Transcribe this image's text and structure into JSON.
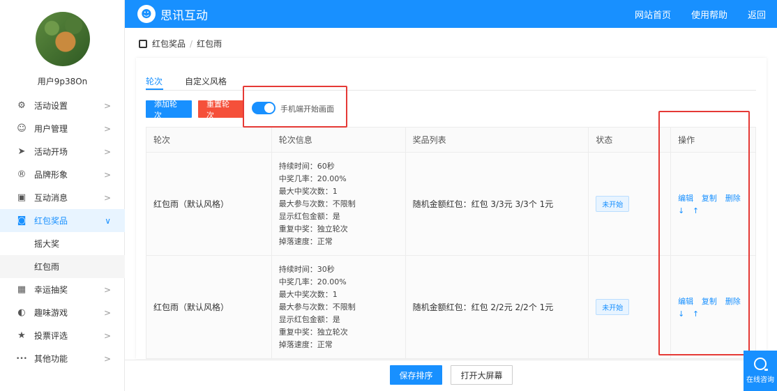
{
  "sidebar": {
    "username": "用户9p38On",
    "items": [
      {
        "label": "活动设置",
        "icon": "gears-icon",
        "glyph": "⚙",
        "arrow": ">"
      },
      {
        "label": "用户管理",
        "icon": "user-icon",
        "glyph": "☺",
        "arrow": ">"
      },
      {
        "label": "活动开场",
        "icon": "send-icon",
        "glyph": "➤",
        "arrow": ">"
      },
      {
        "label": "品牌形象",
        "icon": "registered-icon",
        "glyph": "®",
        "arrow": ">"
      },
      {
        "label": "互动消息",
        "icon": "message-icon",
        "glyph": "▣",
        "arrow": ">"
      },
      {
        "label": "红包奖品",
        "icon": "redpacket-icon",
        "glyph": "◙",
        "arrow": "∨"
      },
      {
        "label": "幸运抽奖",
        "icon": "lottery-icon",
        "glyph": "▦",
        "arrow": ">"
      },
      {
        "label": "趣味游戏",
        "icon": "game-icon",
        "glyph": "◐",
        "arrow": ">"
      },
      {
        "label": "投票评选",
        "icon": "star-icon",
        "glyph": "★",
        "arrow": ">"
      },
      {
        "label": "其他功能",
        "icon": "more-icon",
        "glyph": "•••",
        "arrow": ">"
      }
    ],
    "submenu": [
      "摇大奖",
      "红包雨"
    ]
  },
  "header": {
    "brand": "思讯互动",
    "links": [
      "网站首页",
      "使用帮助",
      "返回"
    ]
  },
  "breadcrumb": {
    "parent": "红包奖品",
    "separator": "/",
    "current": "红包雨"
  },
  "tabs": [
    "轮次",
    "自定义风格"
  ],
  "toolbar": {
    "add_label": "添加轮次",
    "reset_label": "重置轮次",
    "toggle_label": "手机端开始画面"
  },
  "table": {
    "headers": [
      "轮次",
      "轮次信息",
      "奖品列表",
      "状态",
      "操作"
    ],
    "rows": [
      {
        "round": "红包雨（默认风格）",
        "info": [
          "持续时间：60秒",
          "中奖几率：20.00%",
          "最大中奖次数：1",
          "最大参与次数：不限制",
          "显示红包金额：是",
          "重复中奖：独立轮次",
          "掉落速度：正常"
        ],
        "prizes": "随机金额红包：红包 3/3元 3/3个 1元",
        "status": "未开始",
        "ops": [
          "编辑",
          "复制",
          "删除"
        ],
        "arrows": [
          "↓",
          "↑"
        ]
      },
      {
        "round": "红包雨（默认风格）",
        "info": [
          "持续时间：30秒",
          "中奖几率：20.00%",
          "最大中奖次数：1",
          "最大参与次数：不限制",
          "显示红包金额：是",
          "重复中奖：独立轮次",
          "掉落速度：正常"
        ],
        "prizes": "随机金额红包：红包 2/2元 2/2个 1元",
        "status": "未开始",
        "ops": [
          "编辑",
          "复制",
          "删除"
        ],
        "arrows": [
          "↓",
          "↑"
        ]
      }
    ]
  },
  "footer": {
    "save_label": "保存排序",
    "screen_label": "打开大屏幕"
  },
  "support": {
    "label": "在线咨询"
  },
  "colors": {
    "primary": "#1890ff",
    "danger": "#f5503a",
    "highlight": "#e53935"
  }
}
